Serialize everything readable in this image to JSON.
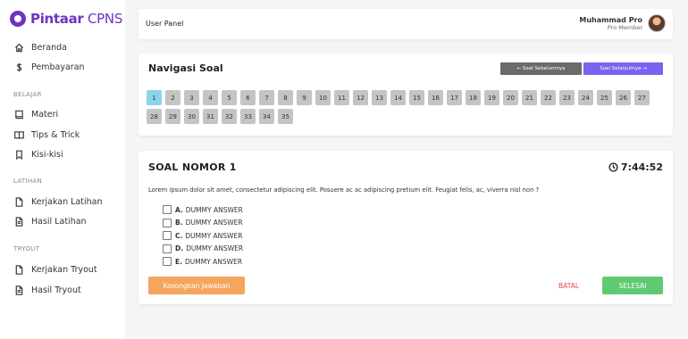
{
  "brand": {
    "bold": "Pintaar",
    "light": " CPNS",
    "color": "#6b35c4"
  },
  "sidebar": {
    "items": [
      {
        "label": "Beranda",
        "icon": "home-icon"
      },
      {
        "label": "Pembayaran",
        "icon": "dollar-icon"
      }
    ],
    "sections": [
      {
        "label": "BELAJAR",
        "items": [
          {
            "label": "Materi",
            "icon": "book-icon"
          },
          {
            "label": "Tips & Trick",
            "icon": "open-book-icon"
          },
          {
            "label": "Kisi-kisi",
            "icon": "bookmark-icon"
          }
        ]
      },
      {
        "label": "LATIHAN",
        "items": [
          {
            "label": "Kerjakan Latihan",
            "icon": "file-icon"
          },
          {
            "label": "Hasil Latihan",
            "icon": "file-text-icon"
          }
        ]
      },
      {
        "label": "TRYOUT",
        "items": [
          {
            "label": "Kerjakan Tryout",
            "icon": "file-icon"
          },
          {
            "label": "Hasil Tryout",
            "icon": "file-text-icon"
          }
        ]
      }
    ]
  },
  "header": {
    "title": "User Panel",
    "user_name": "Muhammad Pro",
    "user_role": "Pro Member"
  },
  "navigation": {
    "title": "Navigasi Soal",
    "prev_label": "← Soal Sebelumnya",
    "next_label": "Soal Selanjutnya →",
    "questions": [
      "1",
      "2",
      "3",
      "4",
      "5",
      "6",
      "7",
      "8",
      "9",
      "10",
      "11",
      "12",
      "13",
      "14",
      "15",
      "16",
      "17",
      "18",
      "19",
      "20",
      "21",
      "22",
      "23",
      "24",
      "25",
      "26",
      "27",
      "28",
      "29",
      "30",
      "31",
      "32",
      "33",
      "34",
      "35"
    ],
    "active": "1"
  },
  "question": {
    "title": "SOAL NOMOR 1",
    "timer": "7:44:52",
    "text": "Lorem ipsum dolor sit amet, consectetur adipiscing elit. Posuere ac ac adipiscing pretium elit. Feugiat felis, ac, viverra nisl non ?",
    "options": [
      {
        "letter": "A.",
        "text": "DUMMY ANSWER"
      },
      {
        "letter": "B.",
        "text": "DUMMY ANSWER"
      },
      {
        "letter": "C.",
        "text": "DUMMY ANSWER"
      },
      {
        "letter": "D.",
        "text": "DUMMY ANSWER"
      },
      {
        "letter": "E.",
        "text": "DUMMY ANSWER"
      }
    ],
    "clear_label": "Kosongkan Jawaban",
    "cancel_label": "BATAL",
    "finish_label": "SELESAI"
  }
}
